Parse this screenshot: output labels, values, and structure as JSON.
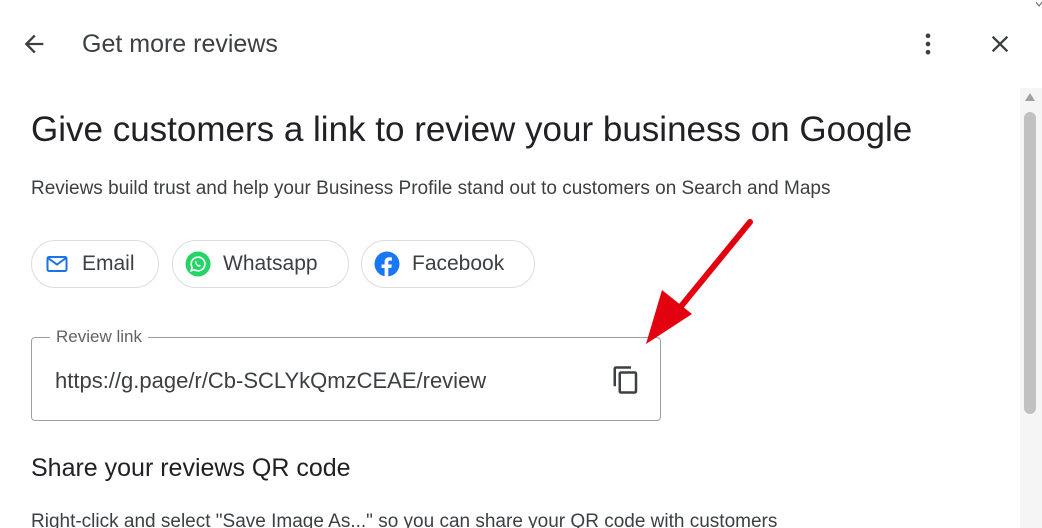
{
  "header": {
    "title": "Get more reviews",
    "back_icon": "arrow-back-icon",
    "more_icon": "more-vert-icon",
    "close_icon": "close-icon"
  },
  "main": {
    "title": "Give customers a link to review your business on Google",
    "subtitle": "Reviews build trust and help your Business Profile stand out to customers on Search and Maps",
    "share_chips": [
      {
        "label": "Email",
        "icon": "mail-icon",
        "color": "#1a73e8"
      },
      {
        "label": "Whatsapp",
        "icon": "whatsapp-icon",
        "color": "#25d366"
      },
      {
        "label": "Facebook",
        "icon": "facebook-icon",
        "color": "#1877f2"
      }
    ],
    "review_link": {
      "label": "Review link",
      "value": "https://g.page/r/Cb-SCLYkQmzCEAE/review",
      "copy_icon": "copy-icon"
    },
    "qr_section": {
      "title": "Share your reviews QR code",
      "description": "Right-click and select \"Save Image As...\" so you can share your QR code with customers"
    }
  },
  "annotation": {
    "arrow_color": "#e3000f"
  }
}
